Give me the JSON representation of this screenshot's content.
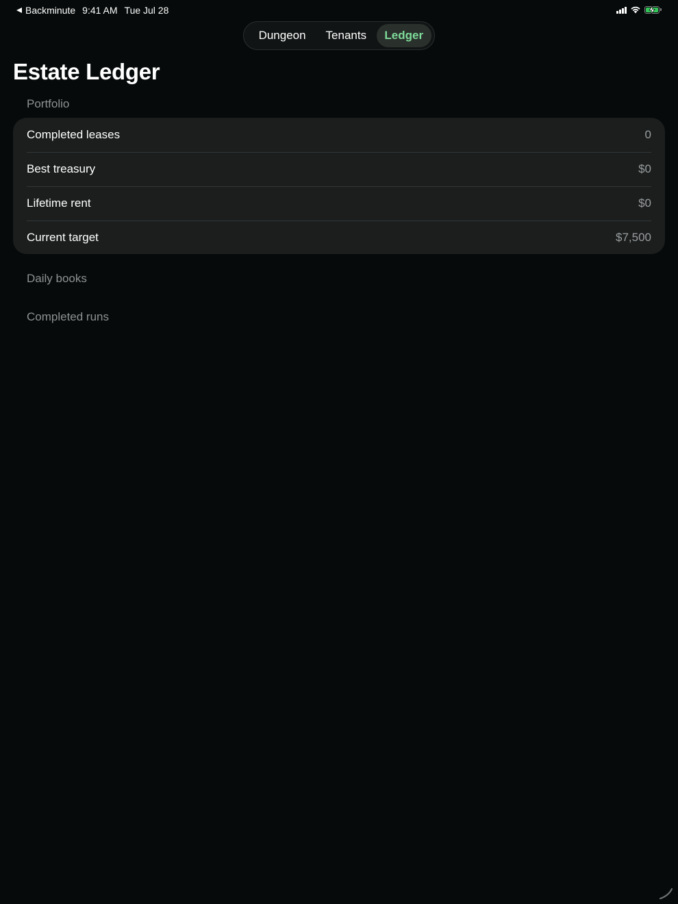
{
  "status_bar": {
    "back_app": "Backminute",
    "time": "9:41 AM",
    "date": "Tue Jul 28",
    "battery_level": 1.0,
    "battery_charging": true,
    "colors": {
      "battery": "#34c759"
    }
  },
  "tabs": [
    {
      "label": "Dungeon",
      "selected": false
    },
    {
      "label": "Tenants",
      "selected": false
    },
    {
      "label": "Ledger",
      "selected": true
    }
  ],
  "accent_color": "#7fdc9a",
  "page_title": "Estate Ledger",
  "sections": {
    "portfolio": {
      "header": "Portfolio",
      "rows": [
        {
          "label": "Completed leases",
          "value": "0"
        },
        {
          "label": "Best treasury",
          "value": "$0"
        },
        {
          "label": "Lifetime rent",
          "value": "$0"
        },
        {
          "label": "Current target",
          "value": "$7,500"
        }
      ]
    },
    "daily_books": {
      "header": "Daily books"
    },
    "completed_runs": {
      "header": "Completed runs"
    }
  }
}
